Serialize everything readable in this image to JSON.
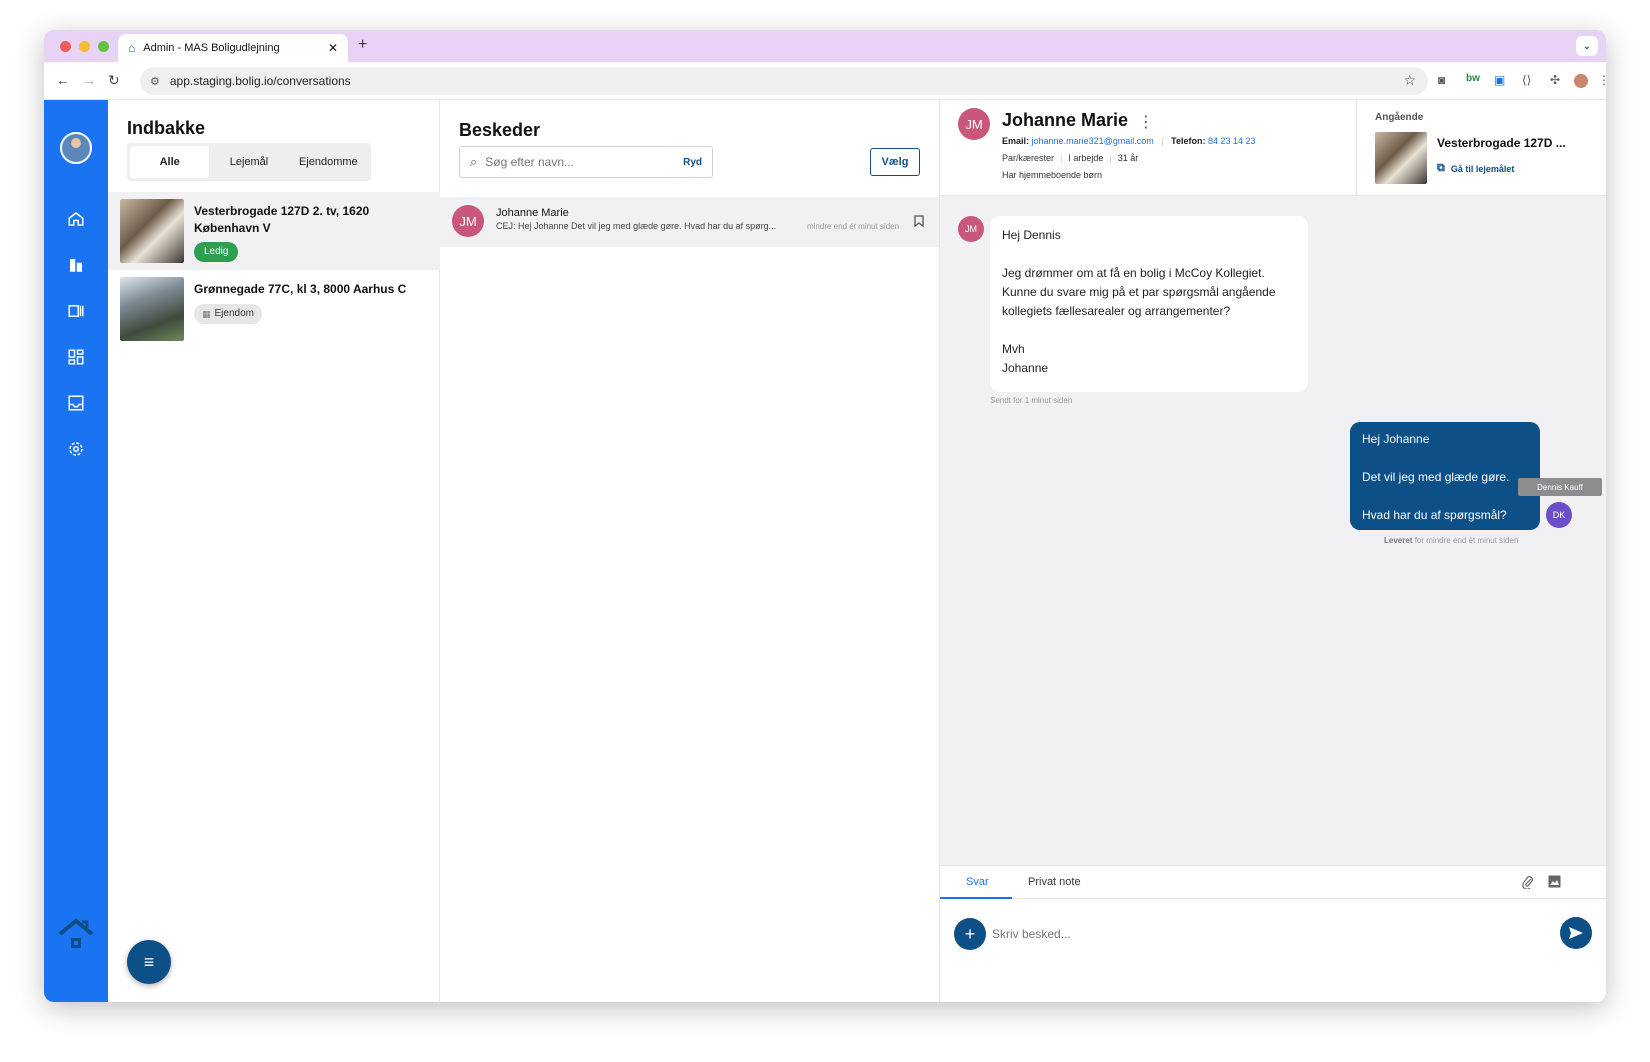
{
  "browser": {
    "tab_title": "Admin - MAS Boligudlejning",
    "url": "app.staging.bolig.io/conversations"
  },
  "inbox": {
    "title": "Indbakke",
    "filters": [
      "Alle",
      "Lejemål",
      "Ejendomme"
    ],
    "active_filter": "Alle",
    "properties": [
      {
        "address": "Vesterbrogade 127D 2. tv, 1620 København V",
        "badge": "Ledig"
      },
      {
        "address": "Grønnegade 77C, kl 3, 8000 Aarhus C",
        "badge": "Ejendom"
      }
    ]
  },
  "messages": {
    "title": "Beskeder",
    "search_placeholder": "Søg efter navn...",
    "clear_label": "Ryd",
    "select_label": "Vælg",
    "conversations": [
      {
        "initials": "JM",
        "name": "Johanne Marie",
        "preview": "CEJ: Hej Johanne Det vil jeg med glæde gøre. Hvad har du af spørg...",
        "time": "mindre end ét minut siden"
      }
    ]
  },
  "chat": {
    "initials": "JM",
    "name": "Johanne Marie",
    "email_label": "Email:",
    "email": "johanne.marie321@gmail.com",
    "phone_label": "Telefon:",
    "phone": "84 23 14 23",
    "meta": [
      "Par/kærester",
      "I arbejde",
      "31 år"
    ],
    "children": "Har hjemmeboende børn",
    "regarding_label": "Angående",
    "regarding_address": "Vesterbrogade 127D ...",
    "goto_label": "Gå til lejemålet",
    "incoming": {
      "initials": "JM",
      "text": "Hej Dennis\n\nJeg drømmer om at få en bolig i McCoy Kollegiet. Kunne du svare mig på et par spørgsmål angående kollegiets fællesarealer og arrangementer?\n\nMvh\nJohanne",
      "time": "Sendt for 1 minut siden"
    },
    "outgoing": {
      "initials": "DK",
      "sender": "Dennis Kauff",
      "text": "Hej Johanne\n\nDet vil jeg med glæde gøre.\n\nHvad har du af spørgsmål?",
      "status": "Leveret",
      "time": "for mindre end ét minut siden"
    },
    "composer": {
      "tabs": [
        "Svar",
        "Privat note"
      ],
      "placeholder": "Skriv besked..."
    }
  },
  "colors": {
    "sidebar": "#1a73f0",
    "primary": "#0d4f87",
    "badge_green": "#2e9e4f",
    "avatar_pink": "#c9577a",
    "avatar_purple": "#6b4fc9"
  }
}
